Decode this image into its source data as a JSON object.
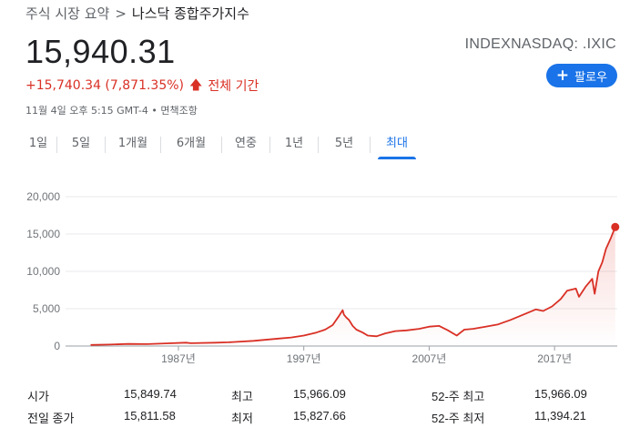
{
  "breadcrumb": {
    "parent": "주식 시장 요약",
    "separator": ">",
    "current": "나스닥 종합주가지수"
  },
  "quote": {
    "price": "15,940.31",
    "ticker": "INDEXNASDAQ: .IXIC",
    "change": "+15,740.34 (7,871.35%)",
    "period": "전체 기간",
    "timestamp": "11월 4일 오후 5:15 GMT-4 • 면책조항",
    "follow_label": "팔로우"
  },
  "tabs": [
    {
      "label": "1일"
    },
    {
      "label": "5일"
    },
    {
      "label": "1개월"
    },
    {
      "label": "6개월"
    },
    {
      "label": "연중"
    },
    {
      "label": "1년"
    },
    {
      "label": "5년"
    },
    {
      "label": "최대",
      "active": true
    }
  ],
  "stats": {
    "open_label": "시가",
    "open": "15,849.74",
    "high_label": "최고",
    "high": "15,966.09",
    "high52_label": "52-주 최고",
    "high52": "15,966.09",
    "prev_close_label": "전일 종가",
    "prev_close": "15,811.58",
    "low_label": "최저",
    "low": "15,827.66",
    "low52_label": "52-주 최저",
    "low52": "11,394.21"
  },
  "colors": {
    "line": "#d93025",
    "accent": "#1a73e8",
    "grid": "#e8eaed",
    "muted": "#70757a"
  },
  "chart_data": {
    "type": "area",
    "x_tick_labels": [
      "1987년",
      "1997년",
      "2007년",
      "2017년"
    ],
    "x_ticks": [
      1987,
      1997,
      2007,
      2017
    ],
    "y_tick_labels": [
      "20,000",
      "15,000",
      "10,000",
      "5,000",
      "0"
    ],
    "y_ticks": [
      20000,
      15000,
      10000,
      5000,
      0
    ],
    "xlim": [
      1978,
      2022
    ],
    "ylim": [
      0,
      20000
    ],
    "grid": true,
    "series": [
      {
        "x": [
          1980.0,
          1981.5,
          1983.0,
          1984.5,
          1986.0,
          1987.6,
          1988.0,
          1990.0,
          1991.0,
          1993.0,
          1995.0,
          1996.0,
          1997.0,
          1998.0,
          1998.7,
          1999.3,
          1999.8,
          2000.1,
          2000.2,
          2000.4,
          2000.6,
          2000.9,
          2001.2,
          2001.7,
          2002.1,
          2002.8,
          2003.5,
          2004.3,
          2005.2,
          2006.2,
          2007.0,
          2007.8,
          2008.5,
          2009.2,
          2009.8,
          2010.5,
          2011.5,
          2012.5,
          2013.5,
          2014.5,
          2015.5,
          2016.1,
          2016.8,
          2017.5,
          2018.0,
          2018.7,
          2018.95,
          2019.5,
          2020.0,
          2020.2,
          2020.5,
          2020.8,
          2021.1,
          2021.5,
          2021.84
        ],
        "y": [
          150,
          200,
          280,
          250,
          350,
          450,
          380,
          450,
          500,
          700,
          1000,
          1150,
          1400,
          1800,
          2200,
          2800,
          4000,
          4800,
          4200,
          3800,
          3500,
          2700,
          2200,
          1800,
          1400,
          1300,
          1700,
          2000,
          2100,
          2300,
          2600,
          2700,
          2100,
          1400,
          2200,
          2300,
          2600,
          2900,
          3500,
          4200,
          4900,
          4700,
          5300,
          6300,
          7400,
          7700,
          6600,
          8000,
          9000,
          7000,
          10000,
          11200,
          13000,
          14500,
          15940
        ]
      }
    ]
  }
}
